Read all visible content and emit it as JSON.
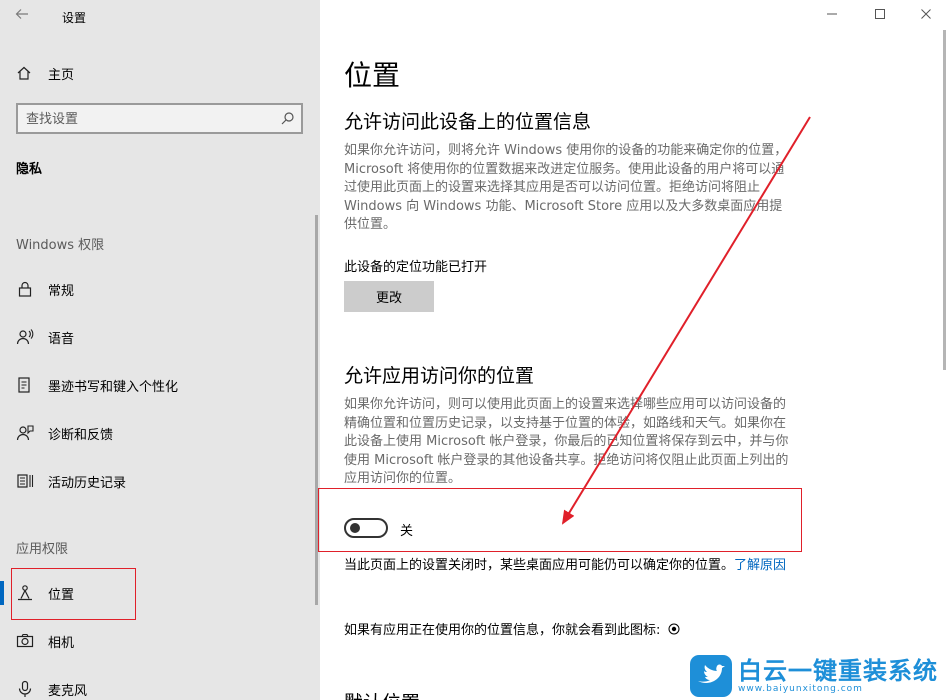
{
  "app": {
    "title": "设置",
    "back_icon": "arrow-left-icon"
  },
  "sidebar": {
    "home_label": "主页",
    "search_placeholder": "查找设置",
    "section_title": "隐私",
    "windows_group": "Windows 权限",
    "windows_items": [
      {
        "label": "常规",
        "icon": "lock-icon"
      },
      {
        "label": "语音",
        "icon": "speech-icon"
      },
      {
        "label": "墨迹书写和键入个性化",
        "icon": "inking-icon"
      },
      {
        "label": "诊断和反馈",
        "icon": "feedback-icon"
      },
      {
        "label": "活动历史记录",
        "icon": "activity-history-icon"
      }
    ],
    "app_group": "应用权限",
    "app_items": [
      {
        "label": "位置",
        "icon": "location-icon",
        "selected": true
      },
      {
        "label": "相机",
        "icon": "camera-icon"
      },
      {
        "label": "麦克风",
        "icon": "microphone-icon"
      }
    ]
  },
  "main": {
    "title": "位置",
    "device_section": {
      "heading": "允许访问此设备上的位置信息",
      "description": "如果你允许访问，则将允许 Windows 使用你的设备的功能来确定你的位置，Microsoft 将使用你的位置数据来改进定位服务。使用此设备的用户将可以通过使用此页面上的设置来选择其应用是否可以访问位置。拒绝访问将阻止 Windows 向 Windows 功能、Microsoft Store 应用以及大多数桌面应用提供位置。",
      "status": "此设备的定位功能已打开",
      "change_button": "更改"
    },
    "app_section": {
      "heading": "允许应用访问你的位置",
      "description": "如果你允许访问，则可以使用此页面上的设置来选择哪些应用可以访问设备的精确位置和位置历史记录，以支持基于位置的体验，如路线和天气。如果你在此设备上使用 Microsoft 帐户登录，你最后的已知位置将保存到云中，并与你使用 Microsoft 帐户登录的其他设备共享。拒绝访问将仅阻止此页面上列出的应用访问你的位置。",
      "toggle_state": false,
      "toggle_label": "关",
      "note": "当此页面上的设置关闭时，某些桌面应用可能仍可以确定你的位置。",
      "note_link": "了解原因",
      "icon_note": "如果有应用正在使用你的位置信息，你就会看到此图标:"
    },
    "default_heading": "默认位置"
  },
  "watermark": {
    "name": "白云一键重装系统",
    "url": "www.baiyunxitong.com"
  },
  "colors": {
    "annotation": "#e0202a",
    "accent": "#0067c0",
    "sidebar_bg": "#e6e6e6"
  }
}
